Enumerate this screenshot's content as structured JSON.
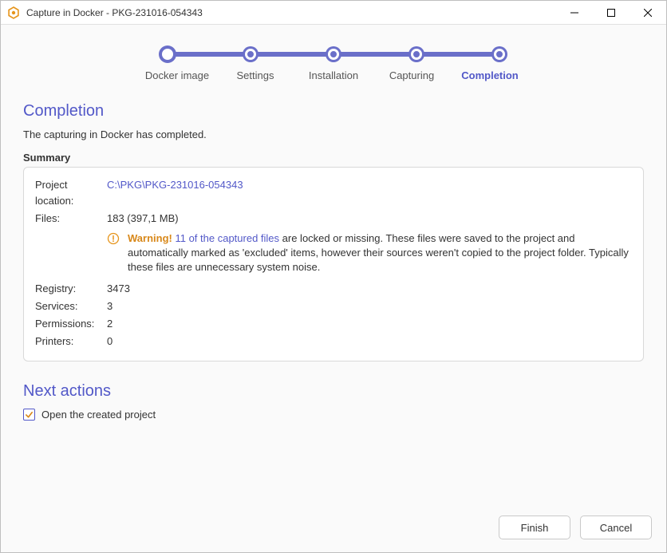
{
  "window": {
    "title": "Capture in Docker - PKG-231016-054343"
  },
  "stepper": {
    "steps": [
      {
        "label": "Docker image"
      },
      {
        "label": "Settings"
      },
      {
        "label": "Installation"
      },
      {
        "label": "Capturing"
      },
      {
        "label": "Completion"
      }
    ]
  },
  "page": {
    "heading": "Completion",
    "subtext": "The capturing in Docker has completed.",
    "summary_label": "Summary",
    "project_location_label": "Project location:",
    "project_location_value": "C:\\PKG\\PKG-231016-054343",
    "files_label": "Files:",
    "files_value": "183 (397,1 MB)",
    "warning_word": "Warning!",
    "warning_link": "11 of the captured files",
    "warning_rest": " are locked or missing. These files were saved to the project and automatically marked as 'excluded' items, however their sources weren't copied to the project folder. Typically these files are unnecessary system noise.",
    "registry_label": "Registry:",
    "registry_value": "3473",
    "services_label": "Services:",
    "services_value": "3",
    "permissions_label": "Permissions:",
    "permissions_value": "2",
    "printers_label": "Printers:",
    "printers_value": "0",
    "next_actions_heading": "Next actions",
    "open_project_label": "Open the created project"
  },
  "buttons": {
    "finish": "Finish",
    "cancel": "Cancel"
  }
}
